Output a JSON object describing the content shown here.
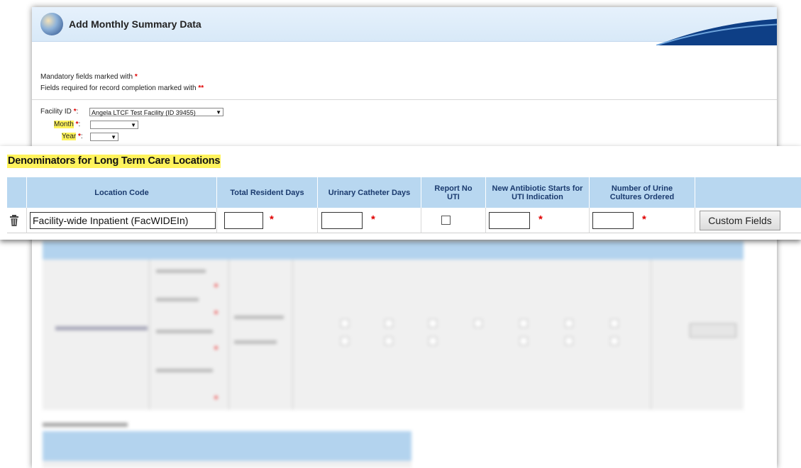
{
  "header": {
    "title": "Add Monthly Summary Data"
  },
  "form": {
    "mandatory_note": "Mandatory fields marked with",
    "mandatory_marker": "*",
    "completion_note": "Fields required for record completion marked with",
    "completion_marker": "**",
    "facility_label": "Facility ID",
    "facility_value": "Angela LTCF Test Facility (ID 39455)",
    "month_label": "Month",
    "month_value": "",
    "year_label": "Year",
    "year_value": "",
    "required_marker": "*",
    "colon": ":"
  },
  "denominators": {
    "title": "Denominators for Long Term Care Locations",
    "columns": [
      "",
      "Location Code",
      "Total Resident Days",
      "Urinary Catheter Days",
      "Report No UTI",
      "New Antibiotic Starts for UTI Indication",
      "Number of Urine Cultures Ordered",
      ""
    ],
    "row": {
      "location": "Facility-wide Inpatient (FacWIDEIn)",
      "total_resident_days": "",
      "urinary_catheter_days": "",
      "report_no_uti": false,
      "new_antibiotic_starts": "",
      "urine_cultures": "",
      "required_marker": "*",
      "custom_fields_label": "Custom Fields"
    }
  },
  "colors": {
    "header_bg": "#b8d7f0",
    "header_text": "#1a3a6e",
    "highlight": "#fff35c",
    "required": "#e00000"
  },
  "icons": [
    "trash-icon",
    "nhsn-logo-icon",
    "header-swoosh"
  ]
}
